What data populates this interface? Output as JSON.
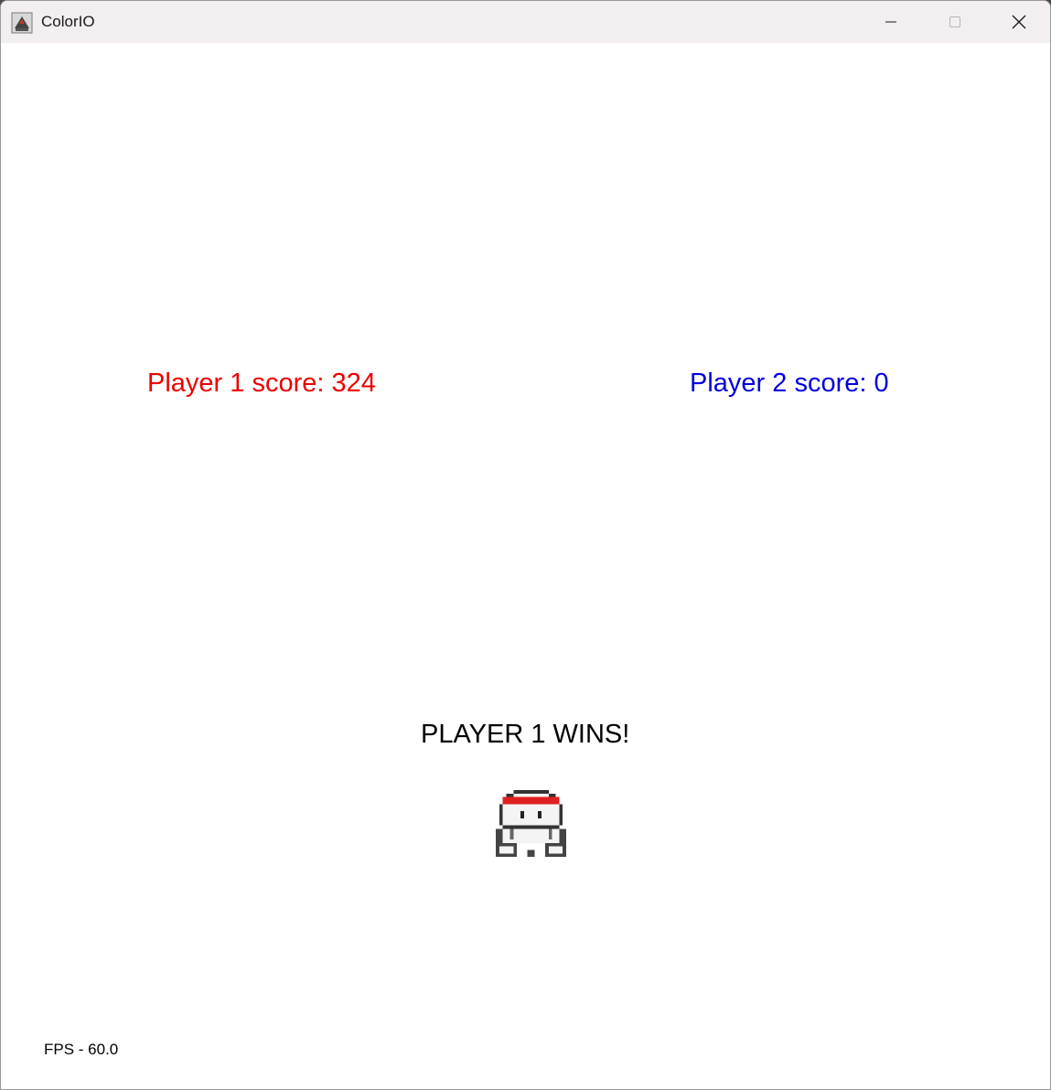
{
  "window": {
    "title": "ColorIO",
    "icon": "java-app-icon",
    "controls": [
      "minimize-icon",
      "maximize-icon",
      "close-icon"
    ]
  },
  "game": {
    "player1_score_text": "Player 1 score: 324",
    "player2_score_text": "Player 2 score: 0",
    "player1_score": 324,
    "player2_score": 0,
    "winner_text": "PLAYER 1 WINS!",
    "fps_text": "FPS - 60.0",
    "fps": 60.0,
    "winner_sprite": "player-1-headband-sprite"
  },
  "colors": {
    "player1": "#ee0000",
    "player2": "#0000dd",
    "text": "#000000",
    "background": "#ffffff",
    "headband": "#e02020"
  }
}
